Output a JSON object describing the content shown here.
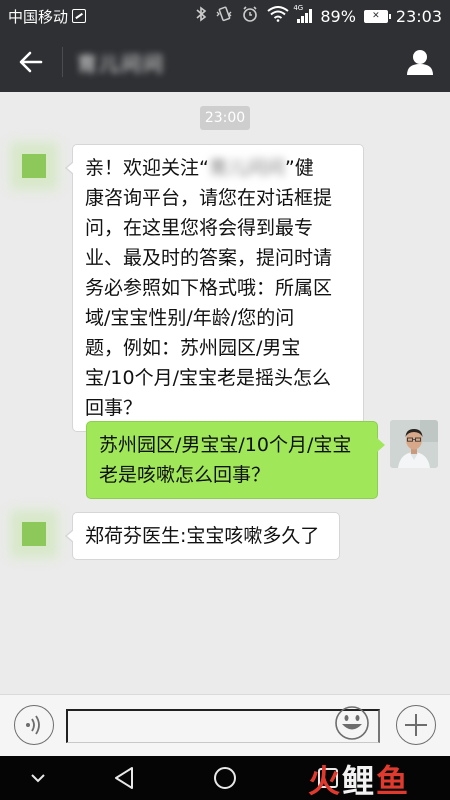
{
  "status_bar": {
    "carrier": "中国移动",
    "network": "4G",
    "battery": "89%",
    "time": "23:03",
    "icons": [
      "bluetooth-icon",
      "vibrate-icon",
      "alarm-icon",
      "wifi-icon",
      "signal-icon",
      "battery-icon"
    ]
  },
  "header": {
    "back_icon": "arrow-left-icon",
    "title": "育儿问问",
    "profile_icon": "person-icon"
  },
  "chat": {
    "time_divider": "23:00",
    "messages": [
      {
        "side": "left",
        "lines": [
          "亲！欢迎关注“",
          "”健",
          "康咨询平台，请您在对话框提",
          "问，在这里您将会得到最专",
          "业、最及时的答案，提问时请",
          "务必参照如下格式哦：所属区",
          "域/宝宝性别/年龄/您的问",
          "题，例如：苏州园区/男宝",
          "宝/10个月/宝宝老是摇头怎么",
          "回事？"
        ],
        "masked": "育儿问问"
      },
      {
        "side": "right",
        "lines": [
          "苏州园区/男宝宝/10个月/宝宝",
          "老是咳嗽怎么回事？"
        ]
      },
      {
        "side": "left",
        "lines": [
          "郑荷芬医生:宝宝咳嗽多久了"
        ]
      }
    ]
  },
  "input_bar": {
    "voice_icon": "voice-icon",
    "text_value": "",
    "emoji_icon": "emoji-icon",
    "plus_icon": "plus-icon"
  },
  "nav_bar": {
    "icons": [
      "chevron-down-icon",
      "back-triangle-icon",
      "home-circle-icon",
      "recents-square-icon"
    ]
  },
  "watermark": {
    "part1": "火",
    "part2": "鲤",
    "part3": "鱼"
  },
  "colors": {
    "topbar": "#2e3033",
    "chat_bg": "#ebebeb",
    "bubble_out": "#a0e75a",
    "bubble_in": "#ffffff"
  }
}
